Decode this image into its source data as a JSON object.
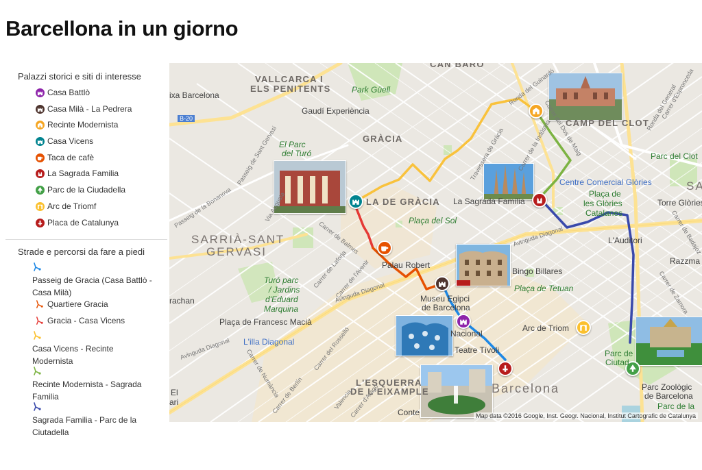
{
  "title": "Barcellona in un giorno",
  "legend": {
    "sites_title": "Palazzi storici e siti di interesse",
    "sites": [
      {
        "label": "Casa Battlò",
        "color": "#8e24aa",
        "icon": "castle-icon"
      },
      {
        "label": "Casa Milà - La Pedrera",
        "color": "#4e342e",
        "icon": "castle-icon"
      },
      {
        "label": "Recinte Modernista",
        "color": "#f5a623",
        "icon": "building-icon"
      },
      {
        "label": "Casa Vicens",
        "color": "#00838f",
        "icon": "castle-icon"
      },
      {
        "label": "Taca de cafè",
        "color": "#e65100",
        "icon": "coffee-icon"
      },
      {
        "label": "La Sagrada Familia",
        "color": "#b71c1c",
        "icon": "church-icon"
      },
      {
        "label": "Parc de la Ciudadella",
        "color": "#43a047",
        "icon": "tree-icon"
      },
      {
        "label": "Arc de Triomf",
        "color": "#fbc02d",
        "icon": "arch-icon"
      },
      {
        "label": "Placa de Catalunya",
        "color": "#b71c1c",
        "icon": "monument-icon"
      }
    ],
    "routes_title": "Strade e percorsi da fare a piedi",
    "routes": [
      {
        "label": "Passeig de Gracia (Casa Battlò - Casa Milà)",
        "color": "#1e88e5"
      },
      {
        "label": "Quartiere Gracia",
        "color": "#e65100"
      },
      {
        "label": "Gracia - Casa Vicens",
        "color": "#e53935"
      },
      {
        "label": "Casa Vicens - Recinte Modernista",
        "color": "#fbc02d"
      },
      {
        "label": "Recinte Modernista - Sagrada Familia",
        "color": "#7cb342"
      },
      {
        "label": "Sagrada Familia - Parc de la Ciutadella",
        "color": "#3949ab"
      }
    ]
  },
  "map": {
    "attribution": "Map data ©2016 Google, Inst. Geogr. Nacional, Institut Cartografic de Catalunya",
    "labels": {
      "can_baro": "CAN BARÓ",
      "vallcarca": "VALLCARCA I",
      "penitents": "ELS PENITENTS",
      "park_guell": "Park Güell",
      "gaudi": "Gaudí Experiència",
      "bcn_top": "ixa Barcelona",
      "b20": "B-20",
      "gracia": "GRÀCIA",
      "el_parc": "El Parc",
      "del_turo": "del Turó",
      "la_gracia": "LA DE GRÀCIA",
      "sagrada": "La Sagrada Família",
      "centre_glories": "Centre Comercial Glòries",
      "placa_glories_1": "Plaça de",
      "placa_glories_2": "les Glòries",
      "placa_glories_3": "Catalanes",
      "torre_glories": "Torre Glòries",
      "parc_clot": "Parc del Clot",
      "camp_clot": "CAMP DEL CLOT",
      "sarria_1": "SARRIÀ-SANT",
      "sarria_2": "GERVASI",
      "placa_sol": "Plaça del Sol",
      "palau_robert": "Palau Robert",
      "bingo": "Bingo Billares",
      "auditori": "L'Auditori",
      "razzma": "Razzma",
      "turo_parc_1": "Turó parc",
      "turo_parc_2": "/ Jardins",
      "turo_parc_3": "d'Eduard",
      "turo_parc_4": "Marquina",
      "placa_tetuan": "Plaça de Tetuan",
      "museu_1": "Museu Egipci",
      "museu_2": "de Barcelona",
      "arachan": "rachan",
      "placa_macia": "Plaça de Francesc Macià",
      "illa_diagonal": "L'illa Diagonal",
      "nacional": "Nacional",
      "arc_triom": "Arc de Triom",
      "teatre_tivoli": "Teatre Tívoli",
      "parc_ciut_1": "Parc de",
      "parc_ciut_2": "Ciutad",
      "esquerra_1": "L'ESQUERRA",
      "esquerra_2": "DE L'EIXAMPLE",
      "barcelona_big": "Barcelona",
      "zoo_1": "Parc Zoològic",
      "zoo_2": "de Barcelona",
      "parc_la": "Parc de la",
      "conte": "Conte",
      "ari": "ari",
      "el_cut": "El",
      "sa": "SA",
      "sant_gervasi": "Passeig de Sant Gervasi",
      "ronda_guinardo": "Ronda del Guinardó",
      "ronda_general": "Ronda del General",
      "via_augusta": "Via Augusta",
      "balmes": "Carrer de Balmes",
      "diagonal": "Avinguda Diagonal",
      "diagonal2": "Avinguda Diagonal",
      "diagonal3": "Avinguda Diagonal",
      "laforja": "Carrer de Laforja",
      "rossello": "Carrer del Rosselló",
      "berlin": "Carrer de Berlín",
      "numancia": "Carrer de Numància",
      "dos_maig": "Carrer del Dos de Maig",
      "industria": "Carrer de la Indústria",
      "travessera": "Travessera de Gràcia",
      "meridiana": "Avinguda Meridiana",
      "espronceda": "Carrer d'Espronceda",
      "badajoz": "Carrer de Badajoz",
      "zamora": "Carrer de Zamora",
      "bonanova": "Passeig de la Bonanova",
      "avenir": "Carrer de l'Avenir",
      "arago": "Carrer d'Aragó",
      "valencia": "Valencia"
    }
  }
}
